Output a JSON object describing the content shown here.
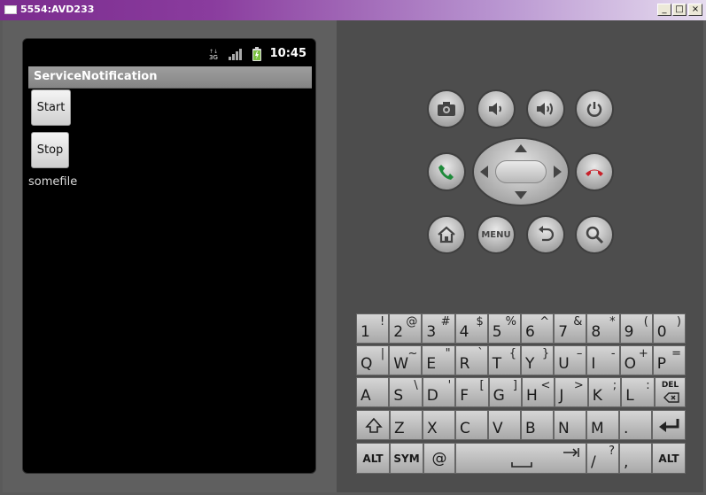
{
  "window": {
    "title": "5554:AVD233",
    "minimize_label": "_",
    "maximize_label": "□",
    "close_label": "×"
  },
  "phone": {
    "status": {
      "time": "10:45",
      "network_label": "3G"
    },
    "app_title": "ServiceNotification",
    "start_label": "Start",
    "stop_label": "Stop",
    "text_view": "somefile"
  },
  "controls": {
    "menu_label": "MENU"
  },
  "keyboard": {
    "row1": [
      {
        "m": "1",
        "s": "!"
      },
      {
        "m": "2",
        "s": "@"
      },
      {
        "m": "3",
        "s": "#"
      },
      {
        "m": "4",
        "s": "$"
      },
      {
        "m": "5",
        "s": "%"
      },
      {
        "m": "6",
        "s": "^"
      },
      {
        "m": "7",
        "s": "&"
      },
      {
        "m": "8",
        "s": "*"
      },
      {
        "m": "9",
        "s": "("
      },
      {
        "m": "0",
        "s": ")"
      }
    ],
    "row2": [
      {
        "m": "Q",
        "s": "|"
      },
      {
        "m": "W",
        "s": "~"
      },
      {
        "m": "E",
        "s": "\""
      },
      {
        "m": "R",
        "s": "`"
      },
      {
        "m": "T",
        "s": "{"
      },
      {
        "m": "Y",
        "s": "}"
      },
      {
        "m": "U",
        "s": "–"
      },
      {
        "m": "I",
        "s": "-"
      },
      {
        "m": "O",
        "s": "+"
      },
      {
        "m": "P",
        "s": "="
      }
    ],
    "row3": [
      {
        "m": "A",
        "s": ""
      },
      {
        "m": "S",
        "s": "\\"
      },
      {
        "m": "D",
        "s": "'"
      },
      {
        "m": "F",
        "s": "["
      },
      {
        "m": "G",
        "s": "]"
      },
      {
        "m": "H",
        "s": "<"
      },
      {
        "m": "J",
        "s": ">"
      },
      {
        "m": "K",
        "s": ";"
      },
      {
        "m": "L",
        "s": ":"
      }
    ],
    "del_label": "DEL",
    "row4": [
      {
        "m": "Z",
        "s": ""
      },
      {
        "m": "X",
        "s": ""
      },
      {
        "m": "C",
        "s": ""
      },
      {
        "m": "V",
        "s": ""
      },
      {
        "m": "B",
        "s": ""
      },
      {
        "m": "N",
        "s": ""
      },
      {
        "m": "M",
        "s": ""
      },
      {
        "m": ".",
        "s": ""
      }
    ],
    "alt_label": "ALT",
    "sym_label": "SYM",
    "at_label": "@",
    "slash_label": "/",
    "slash_shift": "?",
    "comma_label": ","
  }
}
